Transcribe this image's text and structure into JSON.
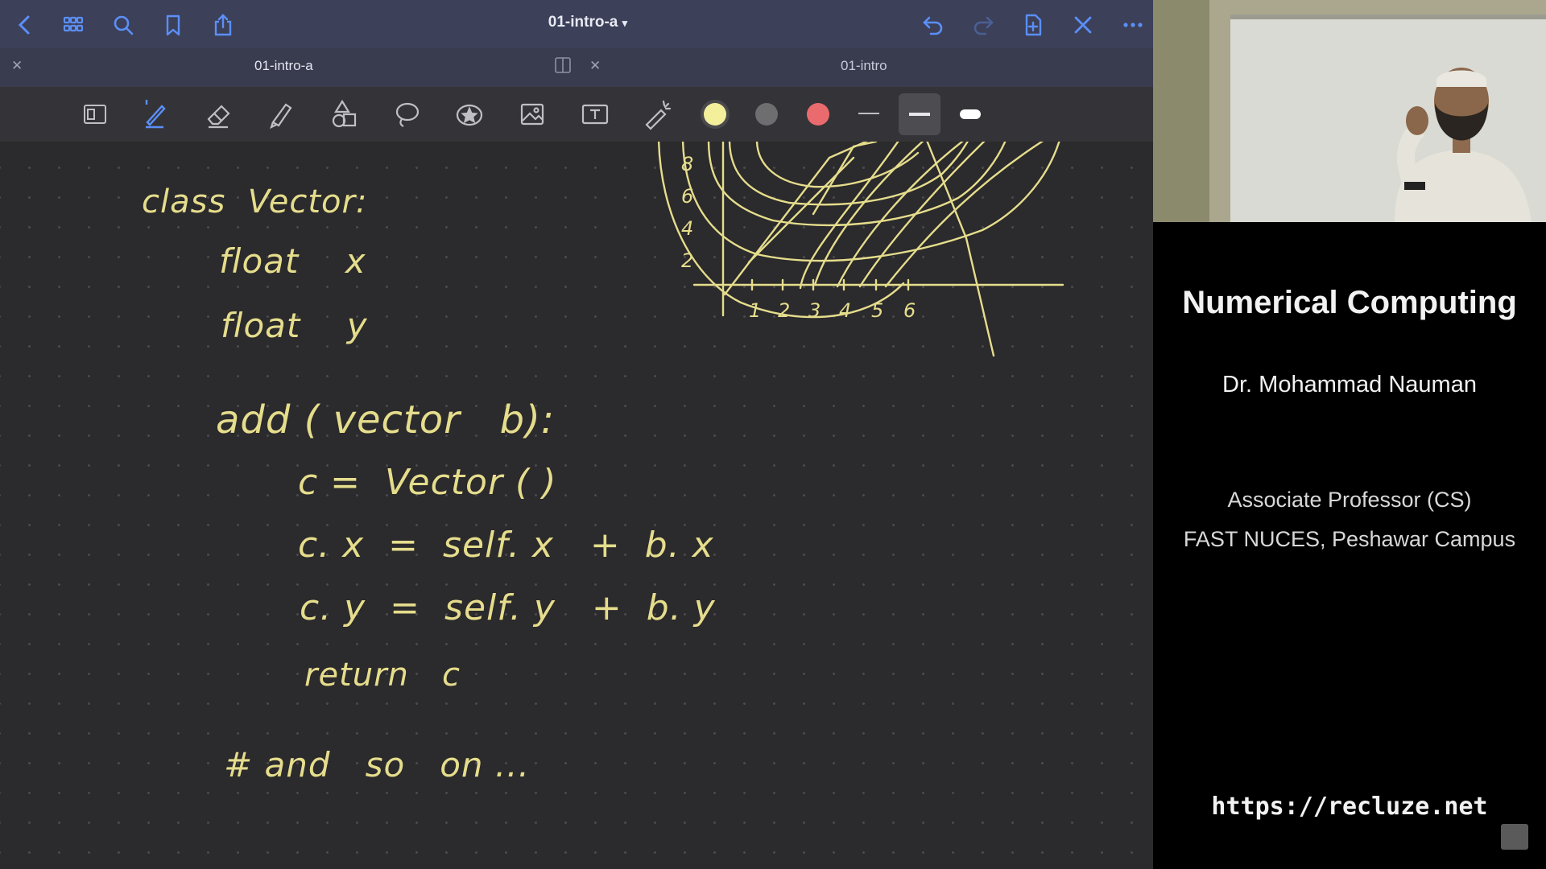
{
  "app": {
    "title": "01-intro-a",
    "tabs": [
      {
        "label": "01-intro-a",
        "active": true
      },
      {
        "label": "01-intro",
        "active": false
      }
    ],
    "topbar_icons": [
      "back-icon",
      "grid-icon",
      "search-icon",
      "bookmark-icon",
      "share-icon",
      "undo-icon",
      "redo-icon",
      "add-page-icon",
      "close-icon",
      "more-icon"
    ],
    "tools": [
      "page-view",
      "pen",
      "eraser",
      "highlighter",
      "shapes",
      "lasso",
      "sticker",
      "image",
      "text",
      "laser-pointer"
    ],
    "colors": [
      "#f4ef9a",
      "#6e6d70",
      "#ea6b6e"
    ],
    "accent": "#5b8ff9"
  },
  "note": {
    "lines": [
      "class  Vector:",
      "float    x",
      "float    y",
      "add ( vector   b):",
      "c =  Vector ( )",
      "c. x  =  self. x   +  b. x",
      "c. y  =  self. y   +  b. y",
      "return   c",
      "# and   so   on ..."
    ],
    "graph_y_ticks": [
      "8",
      "6",
      "4",
      "2"
    ],
    "graph_x_ticks": [
      "1",
      "2",
      "3",
      "4",
      "5",
      "6"
    ],
    "ink_color": "#e5dd8c"
  },
  "sidebar": {
    "course": "Numerical Computing",
    "lecturer": "Dr.  Mohammad Nauman",
    "role": "Associate Professor (CS)",
    "institution": "FAST NUCES, Peshawar Campus",
    "url": "https://recluze.net"
  }
}
